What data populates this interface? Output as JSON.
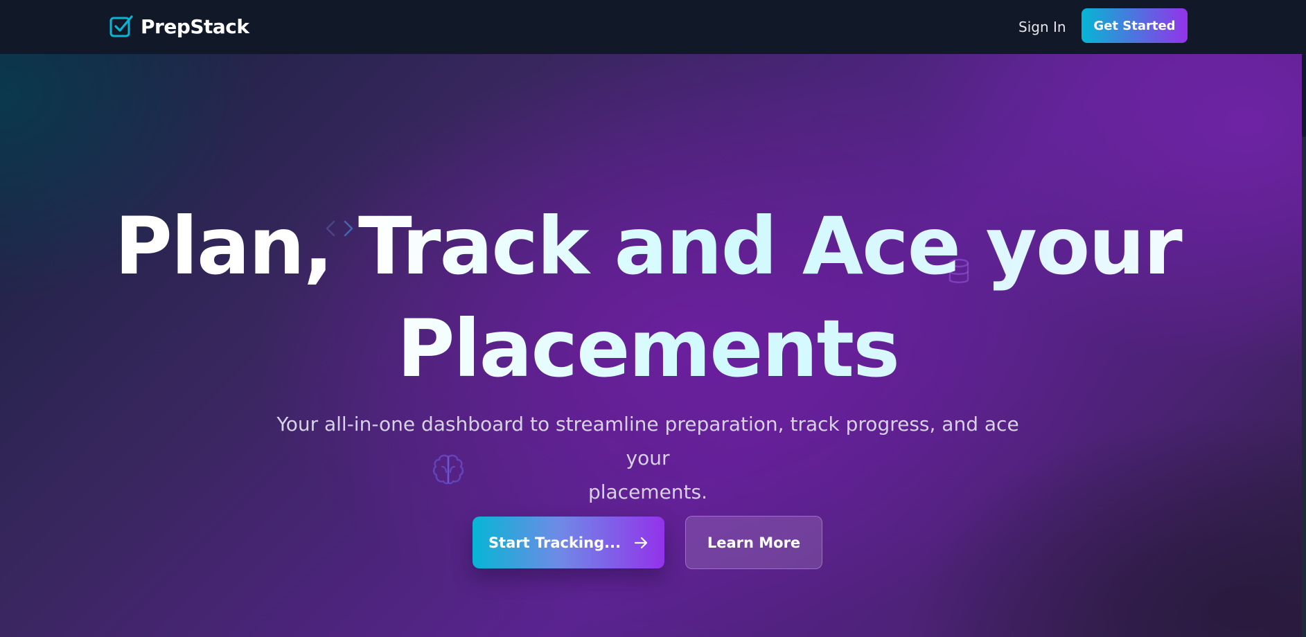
{
  "nav": {
    "brand": "PrepStack",
    "brand_icon": "checkbox-icon",
    "sign_in": "Sign In",
    "get_started": "Get Started"
  },
  "hero": {
    "headline_line1": "Plan, Track and Ace your",
    "headline_line2": "Placements",
    "subtitle_line1": "Your all-in-one dashboard to streamline preparation, track progress, and ace your",
    "subtitle_line2": "placements.",
    "primary_cta": "Start Tracking...",
    "primary_cta_icon": "arrow-right-icon",
    "secondary_cta": "Learn More",
    "decorative_icons": [
      "code-icon",
      "database-icon",
      "brain-icon"
    ]
  },
  "colors": {
    "topbar": "#111827",
    "accent_start": "#06b6d4",
    "accent_end": "#9333ea",
    "hero_purple": "#6b21a8"
  }
}
